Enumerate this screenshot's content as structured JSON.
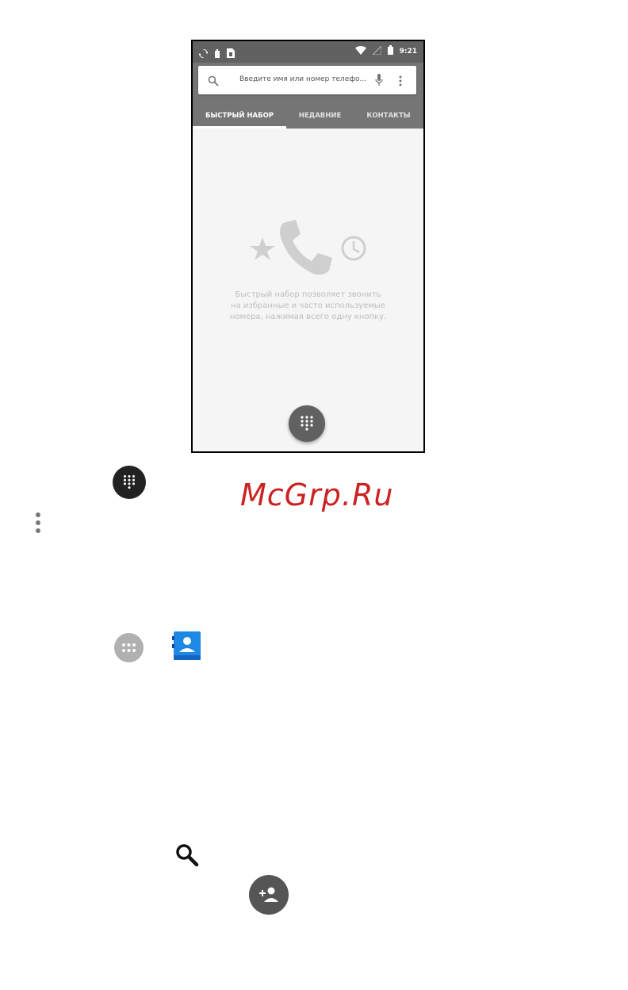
{
  "statusbar": {
    "time": "9:21"
  },
  "search": {
    "placeholder": "Введите имя или номер телефо..."
  },
  "tabs": [
    {
      "label": "БЫСТРЫЙ НАБОР",
      "active": true
    },
    {
      "label": "НЕДАВНИЕ",
      "active": false
    },
    {
      "label": "КОНТАКТЫ",
      "active": false
    }
  ],
  "empty_state": {
    "line1": "Быстрый набор позволяет звонить",
    "line2": "на избранные и часто используемые",
    "line3": "номера, нажимая всего одну кнопку."
  },
  "watermark": "McGrp.Ru",
  "icons": {
    "dialpad": "dialpad-icon",
    "more": "more-vert-icon",
    "apps": "apps-icon",
    "contacts": "contacts-app-icon",
    "search": "search-icon",
    "add_contact": "add-contact-icon"
  },
  "colors": {
    "appbar": "#757575",
    "statusbar": "#616161",
    "watermark": "#cc2222",
    "contacts_blue": "#1e88e5"
  }
}
